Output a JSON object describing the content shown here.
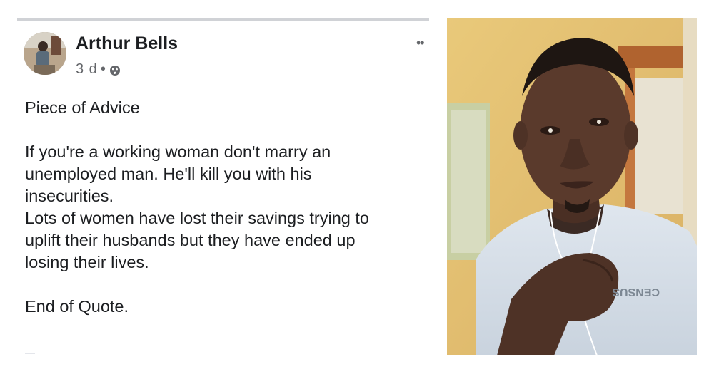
{
  "post": {
    "author": "Arthur Bells",
    "time": "3 d",
    "separator": "•",
    "privacy_icon": "globe-icon",
    "more_icon": "more-options-icon",
    "more_label": "••",
    "title": "Piece of Advice",
    "paragraph1_line1": "If you're a working woman don't marry an",
    "paragraph1_line2": "unemployed man. He'll kill you with his",
    "paragraph1_line3": "insecurities.",
    "paragraph2_line1": "Lots of women have lost their savings trying to",
    "paragraph2_line2": "uplift their husbands but they have ended up",
    "paragraph2_line3": "losing their lives.",
    "closing": "End of Quote."
  },
  "photo": {
    "shirt_text": "CENSUS"
  }
}
